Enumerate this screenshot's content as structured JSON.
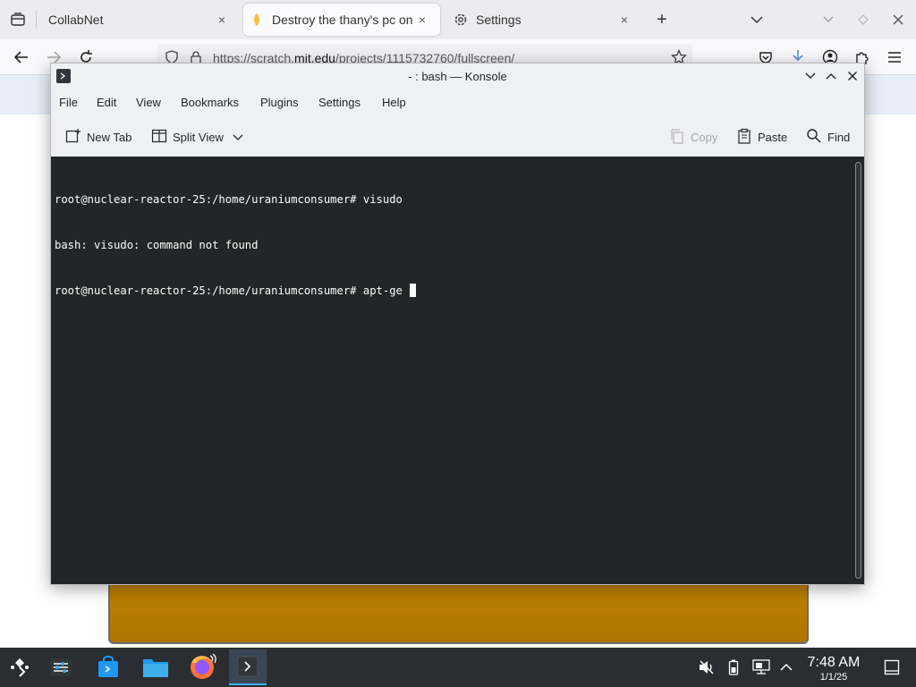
{
  "browser": {
    "tabs": [
      {
        "title": "CollabNet"
      },
      {
        "title": "Destroy the thany's pc on"
      },
      {
        "title": "Settings"
      }
    ],
    "close_glyph": "×",
    "new_tab_glyph": "+",
    "url_prefix": "https://scratch.",
    "url_domain": "mit.edu",
    "url_suffix": "/projects/1115732760/fullscreen/"
  },
  "konsole": {
    "title": "- : bash — Konsole",
    "menus": [
      "File",
      "Edit",
      "View",
      "Bookmarks",
      "Plugins",
      "Settings",
      "Help"
    ],
    "toolbar": {
      "new_tab": "New Tab",
      "split_view": "Split View",
      "copy": "Copy",
      "paste": "Paste",
      "find": "Find"
    },
    "terminal_lines": [
      "root@nuclear-reactor-25:/home/uraniumconsumer# visudo",
      "bash: visudo: command not found",
      "root@nuclear-reactor-25:/home/uraniumconsumer# apt-ge "
    ]
  },
  "taskbar": {
    "time": "7:48 AM",
    "date": "1/1/25"
  },
  "colors": {
    "terminal_bg": "#232627",
    "taskbar_bg": "#2a2e32",
    "accent": "#3daee9",
    "stage_orange": "#c78a00"
  },
  "icons": [
    "tab-list-icon",
    "tab-icon",
    "gear-icon",
    "chevron-down-icon",
    "back-arrow-icon",
    "forward-arrow-icon",
    "reload-icon",
    "shield-icon",
    "lock-icon",
    "star-icon",
    "pocket-icon",
    "download-icon",
    "account-icon",
    "extensions-icon",
    "menu-icon",
    "konsole-icon",
    "minimize-icon",
    "maximize-icon",
    "close-icon",
    "new-tab-icon",
    "split-view-icon",
    "copy-icon",
    "paste-icon",
    "search-icon",
    "app-launcher-icon",
    "settings-icon",
    "discover-icon",
    "dolphin-icon",
    "firefox-icon",
    "volume-muted-icon",
    "battery-icon",
    "network-icon",
    "tray-expand-icon",
    "show-desktop-icon"
  ]
}
